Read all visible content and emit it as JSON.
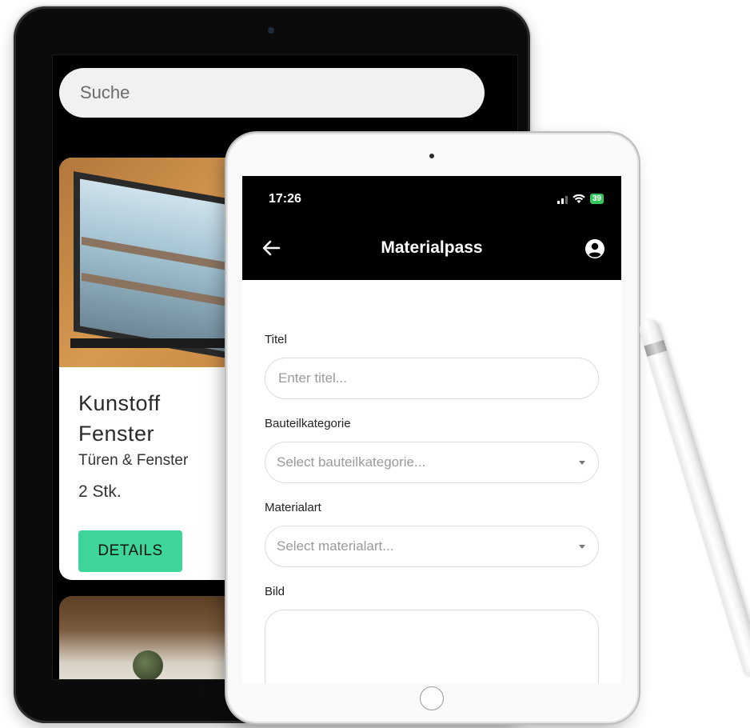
{
  "back_device": {
    "search": {
      "placeholder": "Suche"
    },
    "card": {
      "title": "Kunstoff Fenster",
      "category": "Türen & Fenster",
      "quantity": "2 Stk.",
      "details_label": "DETAILS"
    }
  },
  "front_device": {
    "status_bar": {
      "time": "17:26",
      "battery": "39"
    },
    "header": {
      "title": "Materialpass",
      "back_icon": "arrow-left-icon",
      "profile_icon": "user-circle-icon"
    },
    "form": {
      "titel": {
        "label": "Titel",
        "placeholder": "Enter titel..."
      },
      "bauteilkategorie": {
        "label": "Bauteilkategorie",
        "placeholder": "Select bauteilkategorie..."
      },
      "materialart": {
        "label": "Materialart",
        "placeholder": "Select materialart..."
      },
      "bild": {
        "label": "Bild"
      }
    }
  },
  "colors": {
    "details_button": "#3ed598",
    "header_bg": "#000000",
    "battery": "#34c759"
  }
}
